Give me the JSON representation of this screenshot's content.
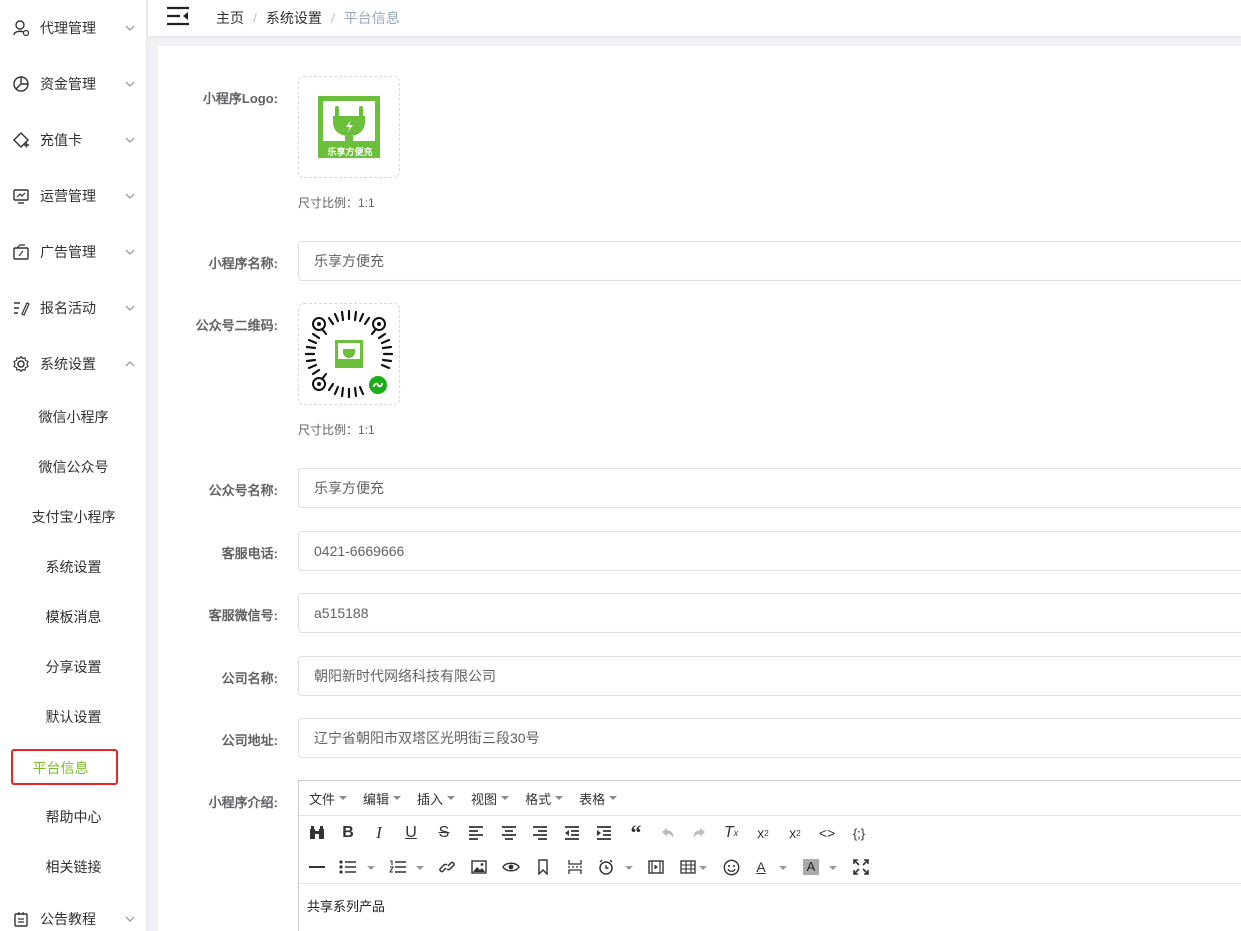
{
  "sidebar": {
    "menus": [
      {
        "label": "代理管理",
        "icon": "user-icon"
      },
      {
        "label": "资金管理",
        "icon": "pie-chart-icon"
      },
      {
        "label": "充值卡",
        "icon": "card-add-icon"
      },
      {
        "label": "运营管理",
        "icon": "monitor-icon"
      },
      {
        "label": "广告管理",
        "icon": "ad-icon"
      },
      {
        "label": "报名活动",
        "icon": "list-edit-icon"
      },
      {
        "label": "系统设置",
        "icon": "gear-icon"
      }
    ],
    "submenus": [
      "微信小程序",
      "微信公众号",
      "支付宝小程序",
      "系统设置",
      "模板消息",
      "分享设置",
      "默认设置",
      "平台信息",
      "帮助中心",
      "相关链接"
    ],
    "last_menu": {
      "label": "公告教程",
      "icon": "notice-icon"
    }
  },
  "breadcrumb": [
    "主页",
    "系统设置",
    "平台信息"
  ],
  "form": {
    "logo_label": "小程序Logo:",
    "logo_text": "乐享方便充",
    "ratio_hint": "尺寸比例：1:1",
    "name_label": "小程序名称:",
    "name_value": "乐享方便充",
    "qrcode_label": "公众号二维码:",
    "qrcode_hint": "尺寸比例：1:1",
    "account_label": "公众号名称:",
    "account_value": "乐享方便充",
    "phone_label": "客服电话:",
    "phone_value": "0421-6669666",
    "wechat_label": "客服微信号:",
    "wechat_value": "a515188",
    "company_label": "公司名称:",
    "company_value": "朝阳新时代网络科技有限公司",
    "address_label": "公司地址:",
    "address_value": "辽宁省朝阳市双塔区光明街三段30号",
    "intro_label": "小程序介绍:"
  },
  "editor": {
    "menus": [
      "文件",
      "编辑",
      "插入",
      "视图",
      "格式",
      "表格"
    ],
    "content": "共享系列产品"
  },
  "colors": {
    "accent": "#7bbd30",
    "highlight_border": "#e8262a",
    "logo_green": "#6cbf3a"
  }
}
